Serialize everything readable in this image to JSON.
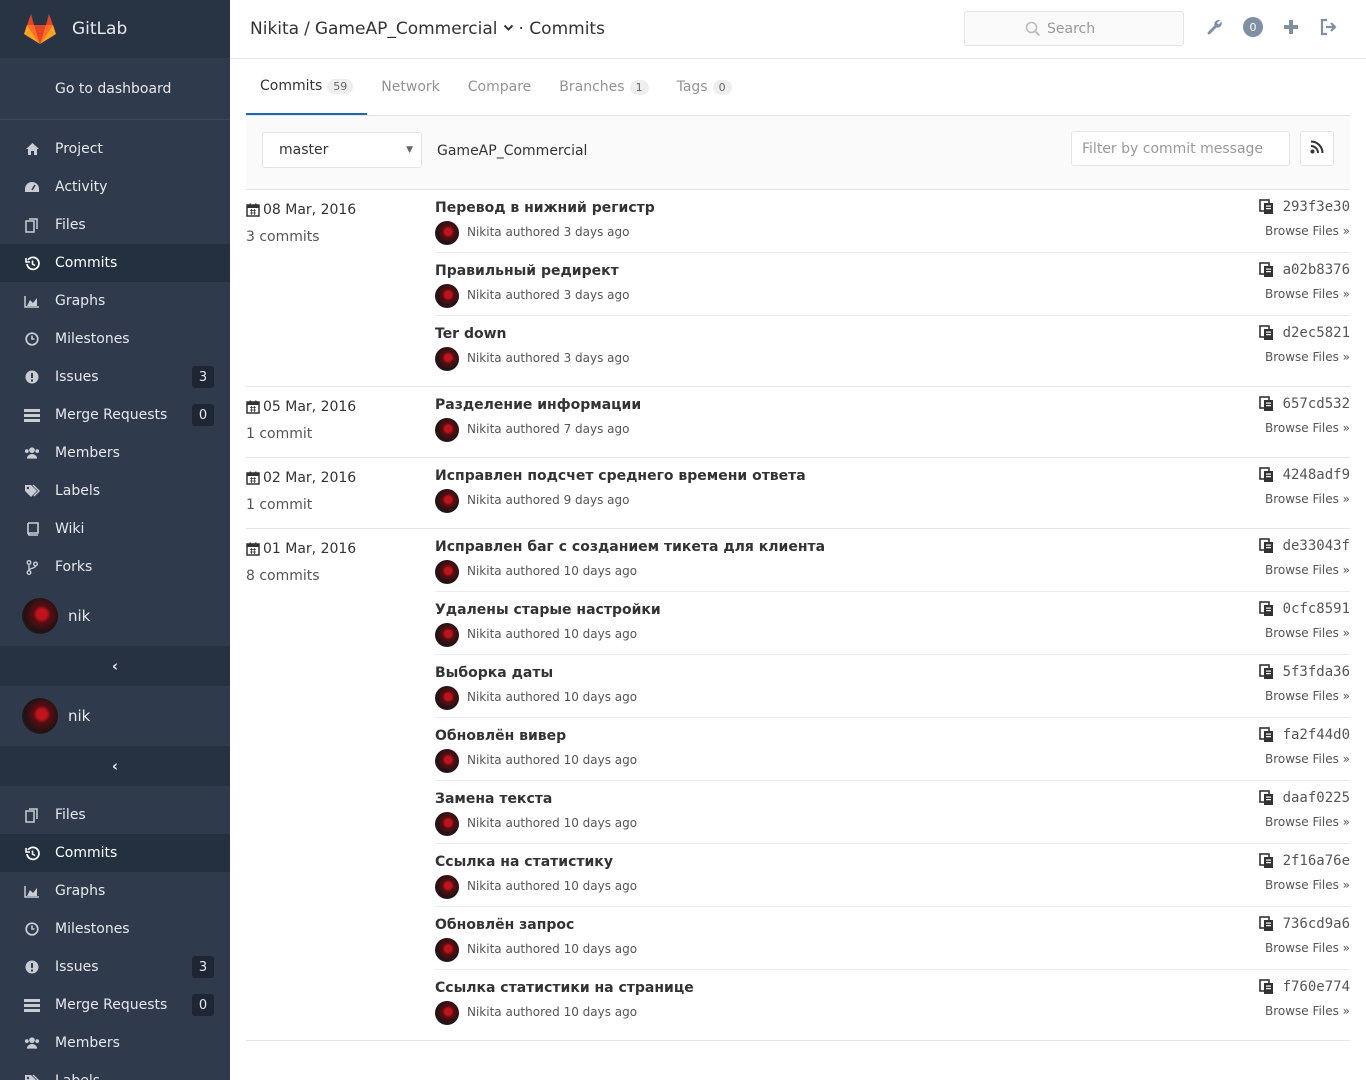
{
  "sidebar": {
    "brand": "GitLab",
    "dashboard_link": "Go to dashboard",
    "nav_primary": [
      {
        "label": "Project",
        "icon": "home-icon"
      },
      {
        "label": "Activity",
        "icon": "dashboard-icon"
      },
      {
        "label": "Files",
        "icon": "files-icon"
      },
      {
        "label": "Commits",
        "icon": "history-icon",
        "active": true
      },
      {
        "label": "Graphs",
        "icon": "area-chart-icon"
      },
      {
        "label": "Milestones",
        "icon": "clock-icon"
      },
      {
        "label": "Issues",
        "icon": "exclamation-circle-icon",
        "badge": "3"
      },
      {
        "label": "Merge Requests",
        "icon": "list-icon",
        "badge": "0"
      },
      {
        "label": "Members",
        "icon": "users-icon"
      },
      {
        "label": "Labels",
        "icon": "tags-icon"
      },
      {
        "label": "Wiki",
        "icon": "book-icon"
      },
      {
        "label": "Forks",
        "icon": "fork-icon"
      }
    ],
    "user_name": "nik",
    "collapse_glyph": "‹",
    "user_name_2": "nik",
    "collapse_glyph_2": "‹",
    "nav_secondary": [
      {
        "label": "Files",
        "icon": "files-icon"
      },
      {
        "label": "Commits",
        "icon": "history-icon",
        "active": true
      },
      {
        "label": "Graphs",
        "icon": "area-chart-icon"
      },
      {
        "label": "Milestones",
        "icon": "clock-icon"
      },
      {
        "label": "Issues",
        "icon": "exclamation-circle-icon",
        "badge": "3"
      },
      {
        "label": "Merge Requests",
        "icon": "list-icon",
        "badge": "0"
      },
      {
        "label": "Members",
        "icon": "users-icon"
      },
      {
        "label": "Labels",
        "icon": "tags-icon"
      }
    ]
  },
  "header": {
    "breadcrumb_owner": "Nikita",
    "breadcrumb_sep": "/",
    "breadcrumb_project": "GameAP_Commercial",
    "breadcrumb_page": "· Commits",
    "search_placeholder": "Search",
    "todo_count": "0"
  },
  "tabs": [
    {
      "label": "Commits",
      "badge": "59",
      "active": true
    },
    {
      "label": "Network"
    },
    {
      "label": "Compare"
    },
    {
      "label": "Branches",
      "badge": "1"
    },
    {
      "label": "Tags",
      "badge": "0"
    }
  ],
  "filter": {
    "branch": "master",
    "project_name": "GameAP_Commercial",
    "placeholder": "Filter by commit message"
  },
  "groups": [
    {
      "date": "08 Mar, 2016",
      "count": "3 commits",
      "commits": [
        {
          "title": "Перевод в нижний регистр",
          "meta": "Nikita authored 3 days ago",
          "sha": "293f3e30",
          "browse": "Browse Files »"
        },
        {
          "title": "Правильный редирект",
          "meta": "Nikita authored 3 days ago",
          "sha": "a02b8376",
          "browse": "Browse Files »"
        },
        {
          "title": "Ter down",
          "meta": "Nikita authored 3 days ago",
          "sha": "d2ec5821",
          "browse": "Browse Files »"
        }
      ]
    },
    {
      "date": "05 Mar, 2016",
      "count": "1 commit",
      "commits": [
        {
          "title": "Разделение информации",
          "meta": "Nikita authored 7 days ago",
          "sha": "657cd532",
          "browse": "Browse Files »"
        }
      ]
    },
    {
      "date": "02 Mar, 2016",
      "count": "1 commit",
      "commits": [
        {
          "title": "Исправлен подсчет среднего времени ответа",
          "meta": "Nikita authored 9 days ago",
          "sha": "4248adf9",
          "browse": "Browse Files »"
        }
      ]
    },
    {
      "date": "01 Mar, 2016",
      "count": "8 commits",
      "commits": [
        {
          "title": "Исправлен баг с созданием тикета для клиента",
          "meta": "Nikita authored 10 days ago",
          "sha": "de33043f",
          "browse": "Browse Files »"
        },
        {
          "title": "Удалены старые настройки",
          "meta": "Nikita authored 10 days ago",
          "sha": "0cfc8591",
          "browse": "Browse Files »"
        },
        {
          "title": "Выборка даты",
          "meta": "Nikita authored 10 days ago",
          "sha": "5f3fda36",
          "browse": "Browse Files »"
        },
        {
          "title": "Обновлён вивер",
          "meta": "Nikita authored 10 days ago",
          "sha": "fa2f44d0",
          "browse": "Browse Files »"
        },
        {
          "title": "Замена текста",
          "meta": "Nikita authored 10 days ago",
          "sha": "daaf0225",
          "browse": "Browse Files »"
        },
        {
          "title": "Ссылка на статистику",
          "meta": "Nikita authored 10 days ago",
          "sha": "2f16a76e",
          "browse": "Browse Files »"
        },
        {
          "title": "Обновлён запрос",
          "meta": "Nikita authored 10 days ago",
          "sha": "736cd9a6",
          "browse": "Browse Files »"
        },
        {
          "title": "Ссылка статистики на странице",
          "meta": "Nikita authored 10 days ago",
          "sha": "f760e774",
          "browse": "Browse Files »"
        }
      ]
    }
  ],
  "colors": {
    "sidebar_bg": "#2f3b4c",
    "sidebar_active": "#233040",
    "accent": "#1b69b6",
    "logo_orange": "#e24329"
  }
}
